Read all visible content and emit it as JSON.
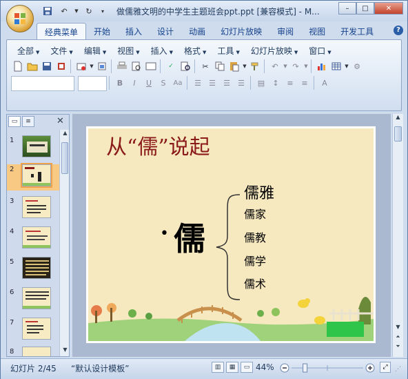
{
  "window": {
    "title": "做儒雅文明的中学生主题班会ppt.ppt [兼容模式] - M...",
    "controls": {
      "minimize": "–",
      "maximize": "□",
      "close": "✕"
    }
  },
  "ribbon": {
    "tabs": [
      "经典菜单",
      "开始",
      "插入",
      "设计",
      "动画",
      "幻灯片放映",
      "审阅",
      "视图",
      "开发工具"
    ],
    "active_tab": "经典菜单",
    "help": "?",
    "menus": [
      "全部",
      "文件",
      "编辑",
      "视图",
      "插入",
      "格式",
      "工具",
      "幻灯片放映",
      "窗口"
    ]
  },
  "slide_pane": {
    "slides": [
      {
        "num": "1",
        "kind": "photo"
      },
      {
        "num": "2",
        "kind": "current"
      },
      {
        "num": "3",
        "kind": "text"
      },
      {
        "num": "4",
        "kind": "text"
      },
      {
        "num": "5",
        "kind": "dark"
      },
      {
        "num": "6",
        "kind": "text"
      },
      {
        "num": "7",
        "kind": "text"
      },
      {
        "num": "8",
        "kind": "text"
      }
    ],
    "selected": "2"
  },
  "slide": {
    "title": "从“儒”说起",
    "main_char": "儒",
    "bullet": "•",
    "branches": [
      "儒雅",
      "儒家",
      "儒教",
      "儒学",
      "儒术"
    ]
  },
  "status": {
    "slide_info": "幻灯片 2/45",
    "theme": "“默认设计模板”",
    "zoom": "44%",
    "zoom_value": 44
  },
  "colors": {
    "title_red": "#8b1a1a",
    "slide_bg": "#f6e8bf",
    "accent_ribbon": "#dfe9f5",
    "selected_thumb": "#f7c982"
  }
}
